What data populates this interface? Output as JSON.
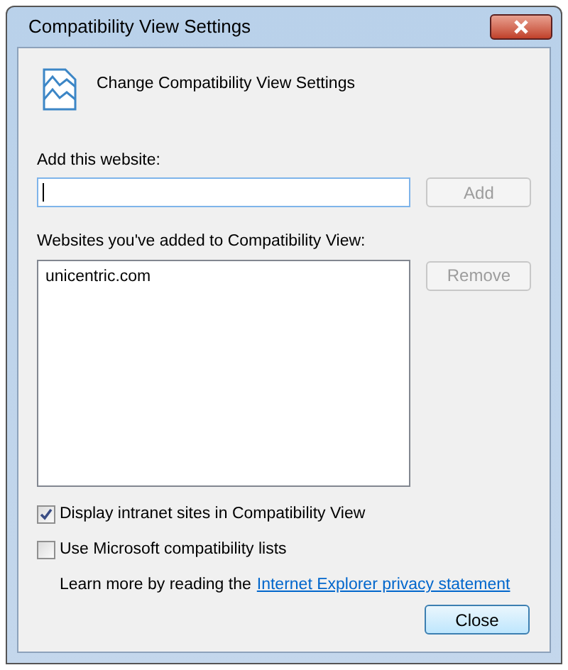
{
  "window": {
    "title": "Compatibility View Settings"
  },
  "header": {
    "title": "Change Compatibility View Settings"
  },
  "add_website": {
    "label": "Add this website:",
    "add_button": {
      "label": "Add",
      "disabled": true
    }
  },
  "websites": {
    "label": "Websites you've added to Compatibility View:",
    "items": [
      {
        "text": "unicentric.com",
        "selected": false
      }
    ],
    "remove_button": {
      "label": "Remove",
      "disabled": true
    }
  },
  "options": [
    {
      "label": "Display intranet sites in Compatibility View",
      "checked": true
    },
    {
      "label": "Use Microsoft compatibility lists",
      "checked": false
    }
  ],
  "privacy": {
    "text": "Learn more by reading the",
    "link": "Internet Explorer privacy statement"
  },
  "buttons": [
    {
      "label": "Close",
      "default": true
    }
  ]
}
